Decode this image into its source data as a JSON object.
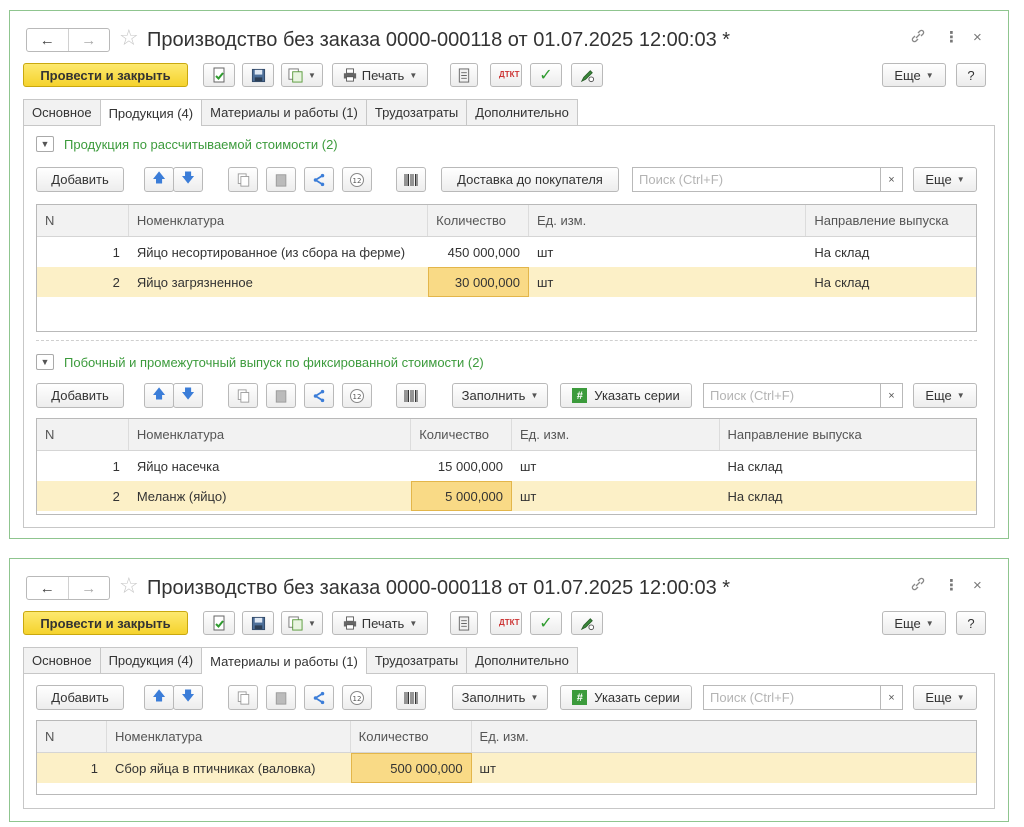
{
  "window": {
    "title": "Производство без заказа 0000-000118 от 01.07.2025 12:00:03 *",
    "back_icon": "←",
    "forward_icon": "→",
    "star_icon": "☆",
    "link_icon": "🔗",
    "menu_icon": "⋮",
    "close_icon": "×"
  },
  "toolbar": {
    "post_close": "Провести и закрыть",
    "print": "Печать",
    "more": "Еще",
    "help": "?",
    "dt_kt": "ДТКТ",
    "check": "✓"
  },
  "tabs": [
    "Основное",
    "Продукция (4)",
    "Материалы и работы (1)",
    "Трудозатраты",
    "Дополнительно"
  ],
  "products": {
    "group_title": "Продукция по рассчитываемой стоимости (2)",
    "add": "Добавить",
    "delivery": "Доставка до покупателя",
    "search_placeholder": "Поиск (Ctrl+F)",
    "clear": "×",
    "more": "Еще",
    "columns": [
      "N",
      "Номенклатура",
      "Количество",
      "Ед. изм.",
      "Направление выпуска"
    ],
    "rows": [
      {
        "n": "1",
        "name": "Яйцо несортированное (из сбора на ферме)",
        "qty": "450 000,000",
        "unit": "шт",
        "dir": "На склад"
      },
      {
        "n": "2",
        "name": "Яйцо загрязненное",
        "qty": "30 000,000",
        "unit": "шт",
        "dir": "На склад"
      }
    ]
  },
  "byproducts": {
    "group_title": "Побочный и промежуточный выпуск по фиксированной стоимости (2)",
    "add": "Добавить",
    "fill": "Заполнить",
    "series": "Указать серии",
    "search_placeholder": "Поиск (Ctrl+F)",
    "clear": "×",
    "more": "Еще",
    "columns": [
      "N",
      "Номенклатура",
      "Количество",
      "Ед. изм.",
      "Направление выпуска"
    ],
    "rows": [
      {
        "n": "1",
        "name": "Яйцо насечка",
        "qty": "15 000,000",
        "unit": "шт",
        "dir": "На склад"
      },
      {
        "n": "2",
        "name": "Меланж (яйцо)",
        "qty": "5 000,000",
        "unit": "шт",
        "dir": "На склад"
      }
    ]
  },
  "materials": {
    "add": "Добавить",
    "fill": "Заполнить",
    "series": "Указать серии",
    "search_placeholder": "Поиск (Ctrl+F)",
    "clear": "×",
    "more": "Еще",
    "columns": [
      "N",
      "Номенклатура",
      "Количество",
      "Ед. изм."
    ],
    "rows": [
      {
        "n": "1",
        "name": "Сбор яйца в птичниках (валовка)",
        "qty": "500 000,000",
        "unit": "шт"
      }
    ]
  },
  "colors": {
    "accent_green": "#3c9b3c",
    "primary_yellow": "#f5d32d",
    "selected_row": "#fcf0c7",
    "border_green": "#8fc58f"
  }
}
